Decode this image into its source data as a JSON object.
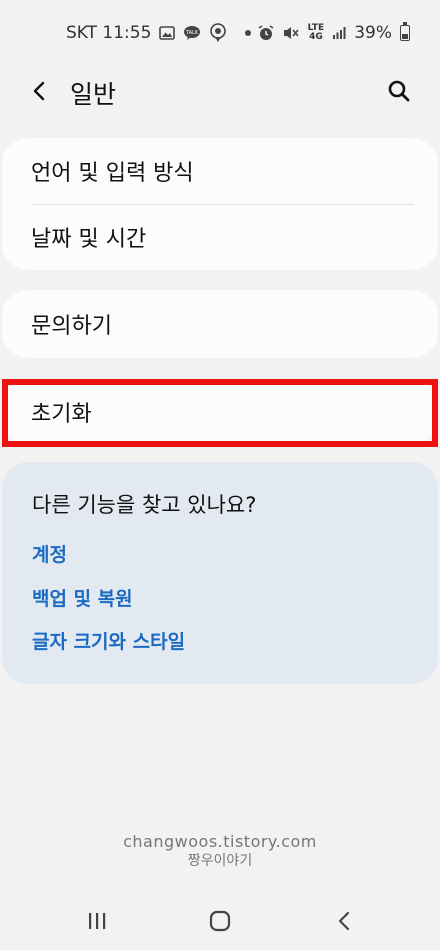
{
  "status_bar": {
    "carrier_time": "SKT 11:55",
    "network": "LTE",
    "network_sub": "4G",
    "battery": "39%",
    "icons": [
      "image-icon",
      "talk-icon",
      "location-icon",
      "alarm-icon",
      "mute-icon",
      "signal-icon",
      "battery-icon"
    ]
  },
  "app_bar": {
    "title": "일반",
    "back_icon": "chevron-left-icon",
    "search_icon": "search-icon"
  },
  "groups": [
    {
      "items": [
        {
          "label": "언어 및 입력 방식"
        },
        {
          "label": "날짜 및 시간"
        }
      ]
    },
    {
      "items": [
        {
          "label": "문의하기"
        }
      ]
    },
    {
      "items": [
        {
          "label": "초기화",
          "highlighted": true
        }
      ]
    }
  ],
  "suggestions": {
    "title": "다른 기능을 찾고 있나요?",
    "links": [
      "계정",
      "백업 및 복원",
      "글자 크기와 스타일"
    ],
    "link_color": "#1c6bc2"
  },
  "watermark": {
    "line1": "changwoos.tistory.com",
    "line2": "짱우이야기"
  },
  "nav_bar": {
    "icons": [
      "recent-apps-icon",
      "home-icon",
      "back-icon"
    ]
  },
  "colors": {
    "background": "#f2f2f2",
    "card": "#fcfcfc",
    "suggest_card": "#e2e9f1",
    "highlight": "#ee1111"
  }
}
